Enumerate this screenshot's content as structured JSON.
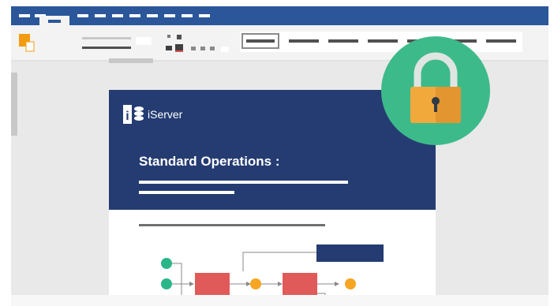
{
  "brand": {
    "logo_mark": "i",
    "name": "iServer"
  },
  "document": {
    "title": "Standard Operations :"
  },
  "icons": {
    "lock": "padlock-icon",
    "logo": "stacked-disks-icon",
    "ribbon_paste": "paste-icon"
  },
  "colors": {
    "titlebar": "#2b579a",
    "header": "#253c72",
    "lock_circle": "#3dba8a",
    "lock_body": "#f2a93b",
    "start_node": "#2bb68a",
    "process_box": "#e05a5a",
    "connector_node": "#f6a623",
    "callout": "#253c72"
  }
}
